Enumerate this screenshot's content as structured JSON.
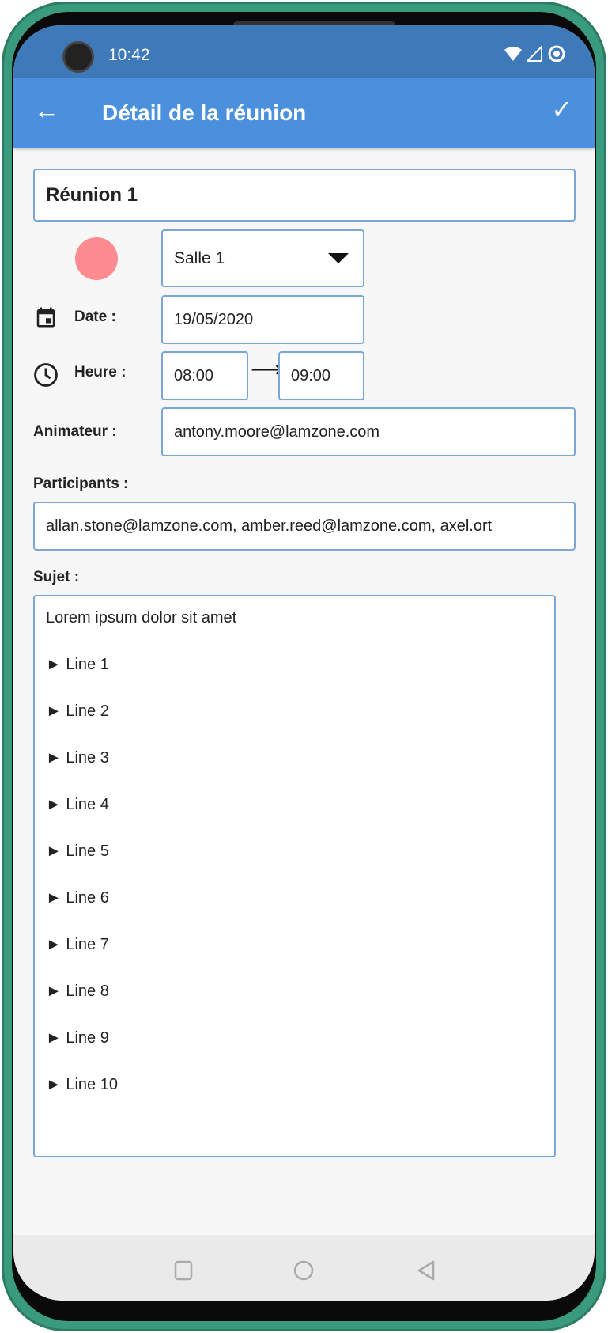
{
  "status": {
    "time": "10:42"
  },
  "appbar": {
    "title": "Détail de la réunion",
    "back_icon": "arrow-back-icon",
    "confirm_icon": "check-icon"
  },
  "form": {
    "meeting_name": "Réunion 1",
    "room_color": "#fe8b90",
    "room": "Salle 1",
    "date_label": "Date :",
    "date": "19/05/2020",
    "time_label": "Heure :",
    "start_time": "08:00",
    "end_time": "09:00",
    "host_label": "Animateur :",
    "host": "antony.moore@lamzone.com",
    "participants_label": "Participants :",
    "participants": "allan.stone@lamzone.com, amber.reed@lamzone.com, axel.ort",
    "subject_label": "Sujet :",
    "subject_lines": [
      "Lorem ipsum dolor sit amet",
      "► Line 1",
      "► Line 2",
      "► Line 3",
      "► Line 4",
      "► Line 5",
      "► Line 6",
      "► Line 7",
      "► Line 8",
      "► Line 9",
      "► Line 10"
    ]
  }
}
